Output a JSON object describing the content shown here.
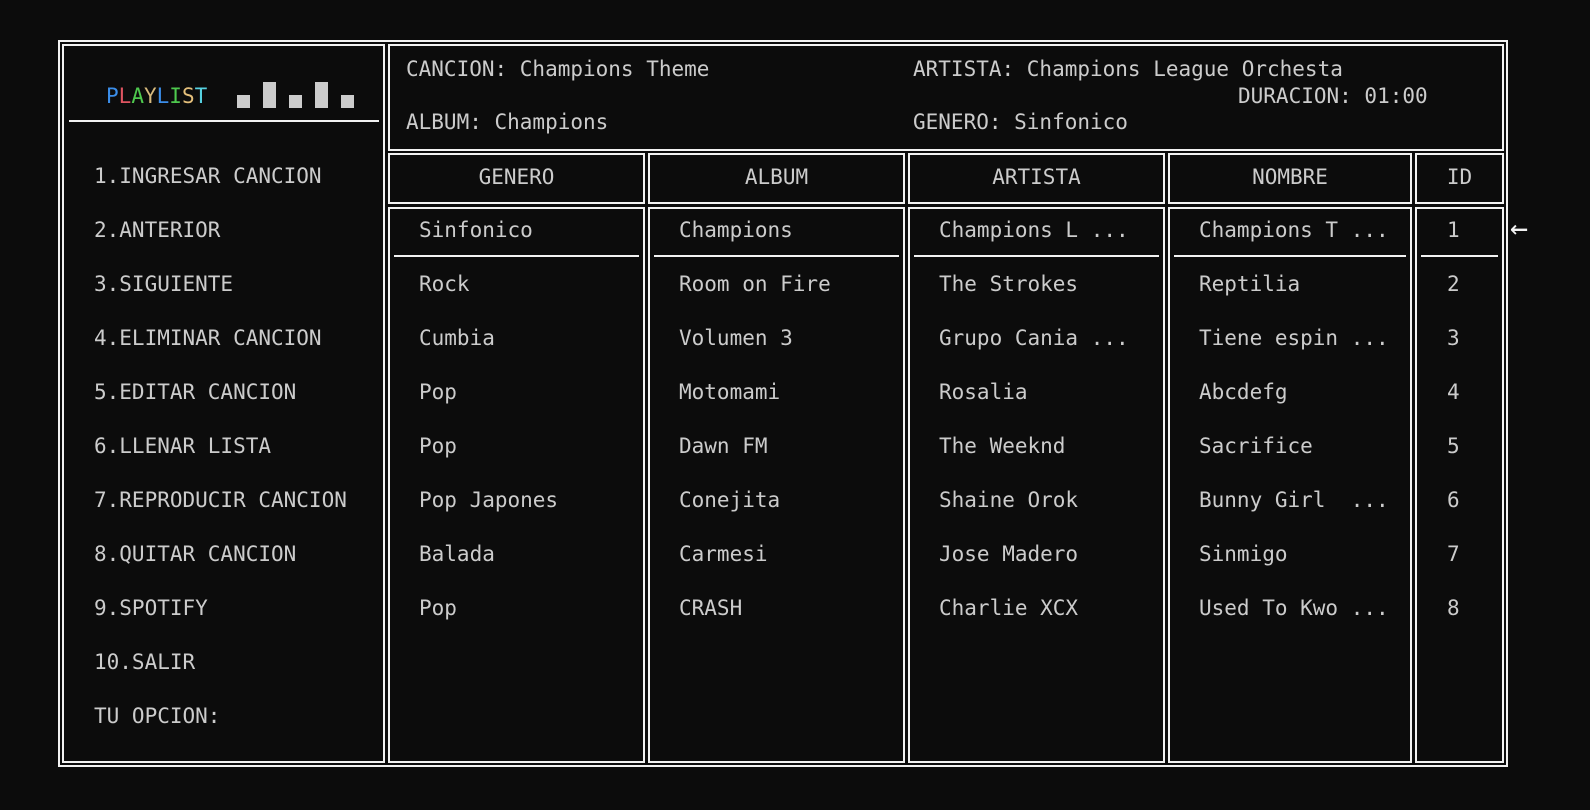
{
  "logo": {
    "letters": [
      "P",
      "L",
      "A",
      "Y",
      "L",
      "I",
      "S",
      "T"
    ],
    "colors": [
      "#3b8eea",
      "#e05561",
      "#4ec94e",
      "#d7ba7d",
      "#3b8eea",
      "#4ec94e",
      "#e5c07b",
      "#56d1e0"
    ]
  },
  "menu": {
    "items": [
      "1.INGRESAR CANCION",
      "2.ANTERIOR",
      "3.SIGUIENTE",
      "4.ELIMINAR CANCION",
      "5.EDITAR CANCION",
      "6.LLENAR LISTA",
      "7.REPRODUCIR CANCION",
      "8.QUITAR CANCION",
      "9.SPOTIFY",
      "10.SALIR"
    ],
    "prompt": "TU OPCION:"
  },
  "now_playing": {
    "song": "CANCION: Champions Theme",
    "artist": "ARTISTA: Champions League Orchesta",
    "duration": "DURACION: 01:00",
    "album": "ALBUM: Champions",
    "genre": "GENERO: Sinfonico"
  },
  "table": {
    "headers": {
      "genre": "GENERO",
      "album": "ALBUM",
      "artist": "ARTISTA",
      "name": "NOMBRE",
      "id": "ID"
    },
    "rows": [
      {
        "genre": "Sinfonico",
        "album": "Champions",
        "artist": "Champions L ...",
        "name": "Champions T ...",
        "id": "1"
      },
      {
        "genre": "Rock",
        "album": "Room on Fire",
        "artist": "The Strokes",
        "name": "Reptilia",
        "id": "2"
      },
      {
        "genre": "Cumbia",
        "album": "Volumen 3",
        "artist": "Grupo Cania ...",
        "name": "Tiene espin ...",
        "id": "3"
      },
      {
        "genre": "Pop",
        "album": "Motomami",
        "artist": "Rosalia",
        "name": "Abcdefg",
        "id": "4"
      },
      {
        "genre": "Pop",
        "album": "Dawn FM",
        "artist": "The Weeknd",
        "name": "Sacrifice",
        "id": "5"
      },
      {
        "genre": "Pop Japones",
        "album": "Conejita",
        "artist": "Shaine Orok",
        "name": "Bunny Girl  ...",
        "id": "6"
      },
      {
        "genre": "Balada",
        "album": "Carmesi",
        "artist": "Jose Madero",
        "name": "Sinmigo",
        "id": "7"
      },
      {
        "genre": "Pop",
        "album": "CRASH",
        "artist": "Charlie XCX",
        "name": "Used To Kwo ...",
        "id": "8"
      }
    ]
  },
  "current_marker": "←"
}
